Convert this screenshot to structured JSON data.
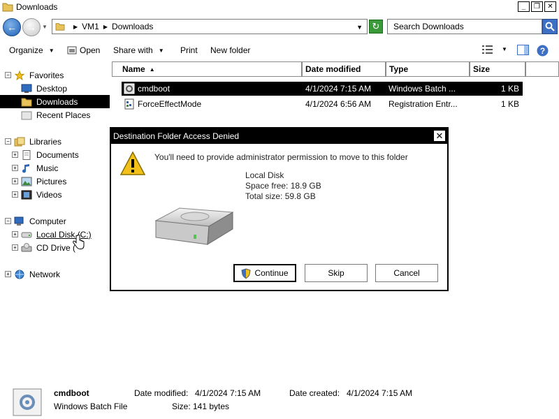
{
  "window": {
    "title": "Downloads",
    "minimize": "_",
    "restore": "❐",
    "close": "✕"
  },
  "address": {
    "crumbs": [
      "VM1",
      "Downloads"
    ],
    "search_placeholder": "Search Downloads"
  },
  "toolbar": {
    "organize": "Organize",
    "open": "Open",
    "share_with": "Share with",
    "print": "Print",
    "new_folder": "New folder"
  },
  "nav": {
    "favorites": "Favorites",
    "desktop": "Desktop",
    "downloads": "Downloads",
    "recent_places": "Recent Places",
    "libraries": "Libraries",
    "documents": "Documents",
    "music": "Music",
    "pictures": "Pictures",
    "videos": "Videos",
    "computer": "Computer",
    "local_disk": "Local Disk (C:)",
    "cd_drive": "CD Drive (",
    "network": "Network"
  },
  "columns": {
    "name": "Name",
    "date_modified": "Date modified",
    "type": "Type",
    "size": "Size"
  },
  "files": [
    {
      "name": "cmdboot",
      "date": "4/1/2024 7:15 AM",
      "type": "Windows Batch ...",
      "size": "1 KB"
    },
    {
      "name": "ForceEffectMode",
      "date": "4/1/2024 6:56 AM",
      "type": "Registration Entr...",
      "size": "1 KB"
    }
  ],
  "dialog": {
    "title": "Destination Folder Access Denied",
    "close": "✕",
    "message": "You'll need to provide administrator permission to move to this folder",
    "disk_name": "Local Disk",
    "space_free": "Space free: 18.9 GB",
    "total_size": "Total size: 59.8 GB",
    "continue": "Continue",
    "skip": "Skip",
    "cancel": "Cancel"
  },
  "details": {
    "name": "cmdboot",
    "type": "Windows Batch File",
    "date_modified_label": "Date modified:",
    "date_modified": "4/1/2024 7:15 AM",
    "date_created_label": "Date created:",
    "date_created": "4/1/2024 7:15 AM",
    "size_label": "Size:",
    "size": "141 bytes"
  },
  "colors": {
    "accent": "#1f5fb5",
    "selection": "#000000",
    "warning": "#f2c21a"
  },
  "icons": [
    "folder-icon",
    "back-icon",
    "forward-icon",
    "refresh-icon",
    "search-icon",
    "star-icon",
    "desktop-icon",
    "library-icon",
    "computer-icon",
    "network-icon",
    "warning-icon",
    "drive-icon",
    "shield-icon",
    "batch-file-icon"
  ]
}
